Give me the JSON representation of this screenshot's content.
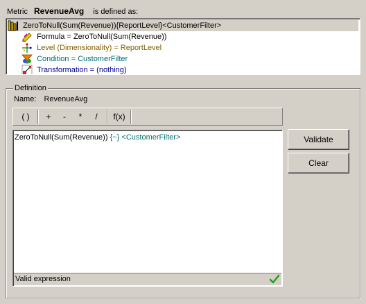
{
  "header": {
    "prefix": "Metric",
    "metric_name": "RevenueAvg",
    "suffix": "is defined as:"
  },
  "tree": {
    "root": "ZeroToNull(Sum(Revenue)){ReportLevel}<CustomerFilter>",
    "items": [
      {
        "label": "Formula = ZeroToNull(Sum(Revenue))",
        "icon": "formula-icon",
        "color": "#000000"
      },
      {
        "label": "Level (Dimensionality) = ReportLevel",
        "icon": "level-icon",
        "color": "#806000"
      },
      {
        "label": "Condition = CustomerFilter",
        "icon": "condition-icon",
        "color": "#007070"
      },
      {
        "label": "Transformation = (nothing)",
        "icon": "transformation-icon",
        "color": "#000090"
      }
    ]
  },
  "definition": {
    "group_label": "Definition",
    "name_label": "Name:",
    "name_value": "RevenueAvg",
    "toolbar": {
      "parens": "( )",
      "plus": "+",
      "minus": "-",
      "multiply": "*",
      "divide": "/",
      "function": "f(x)"
    },
    "expression": {
      "formula": "ZeroToNull(Sum(Revenue))",
      "level": "{~}",
      "condition": "<CustomerFilter>"
    },
    "status": "Valid expression"
  },
  "buttons": {
    "validate": "Validate",
    "clear": "Clear"
  }
}
